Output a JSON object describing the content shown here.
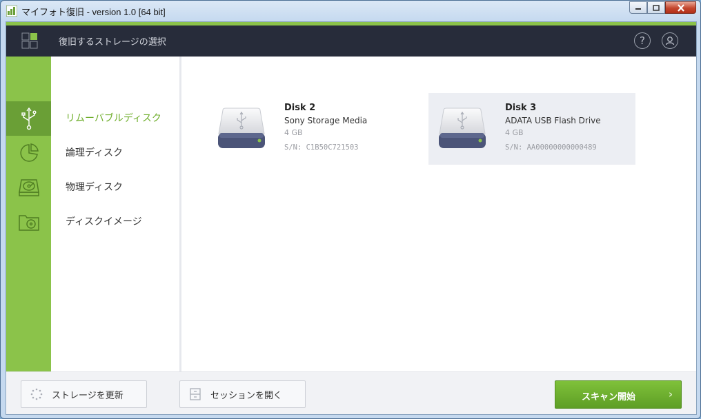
{
  "window": {
    "title": "マイフォト復旧 - version 1.0 [64 bit]",
    "minimize_icon": "minimize-icon",
    "maximize_icon": "maximize-icon",
    "close_icon": "close-icon"
  },
  "header": {
    "title": "復旧するストレージの選択",
    "logo_icon": "app-logo-icon",
    "help_icon": "help-icon",
    "user_icon": "user-icon"
  },
  "sidebar": {
    "items": [
      {
        "label": "リムーバブルディスク",
        "icon": "usb-icon",
        "active": true
      },
      {
        "label": "論理ディスク",
        "icon": "pie-partition-icon",
        "active": false
      },
      {
        "label": "物理ディスク",
        "icon": "hard-disk-icon",
        "active": false
      },
      {
        "label": "ディスクイメージ",
        "icon": "disk-image-folder-icon",
        "active": false
      }
    ]
  },
  "disks": [
    {
      "name": "Disk 2",
      "model": "Sony Storage Media",
      "size": "4 GB",
      "serial": "S/N: C1B50C721503",
      "selected": false
    },
    {
      "name": "Disk 3",
      "model": "ADATA USB Flash Drive",
      "size": "4 GB",
      "serial": "S/N: AA00000000000489",
      "selected": true
    }
  ],
  "footer": {
    "refresh_label": "ストレージを更新",
    "open_session_label": "セッションを開く",
    "scan_label": "スキャン開始"
  },
  "colors": {
    "accent_green": "#8bc34a",
    "header_bg": "#272c3a",
    "active_text": "#6fae2c"
  }
}
